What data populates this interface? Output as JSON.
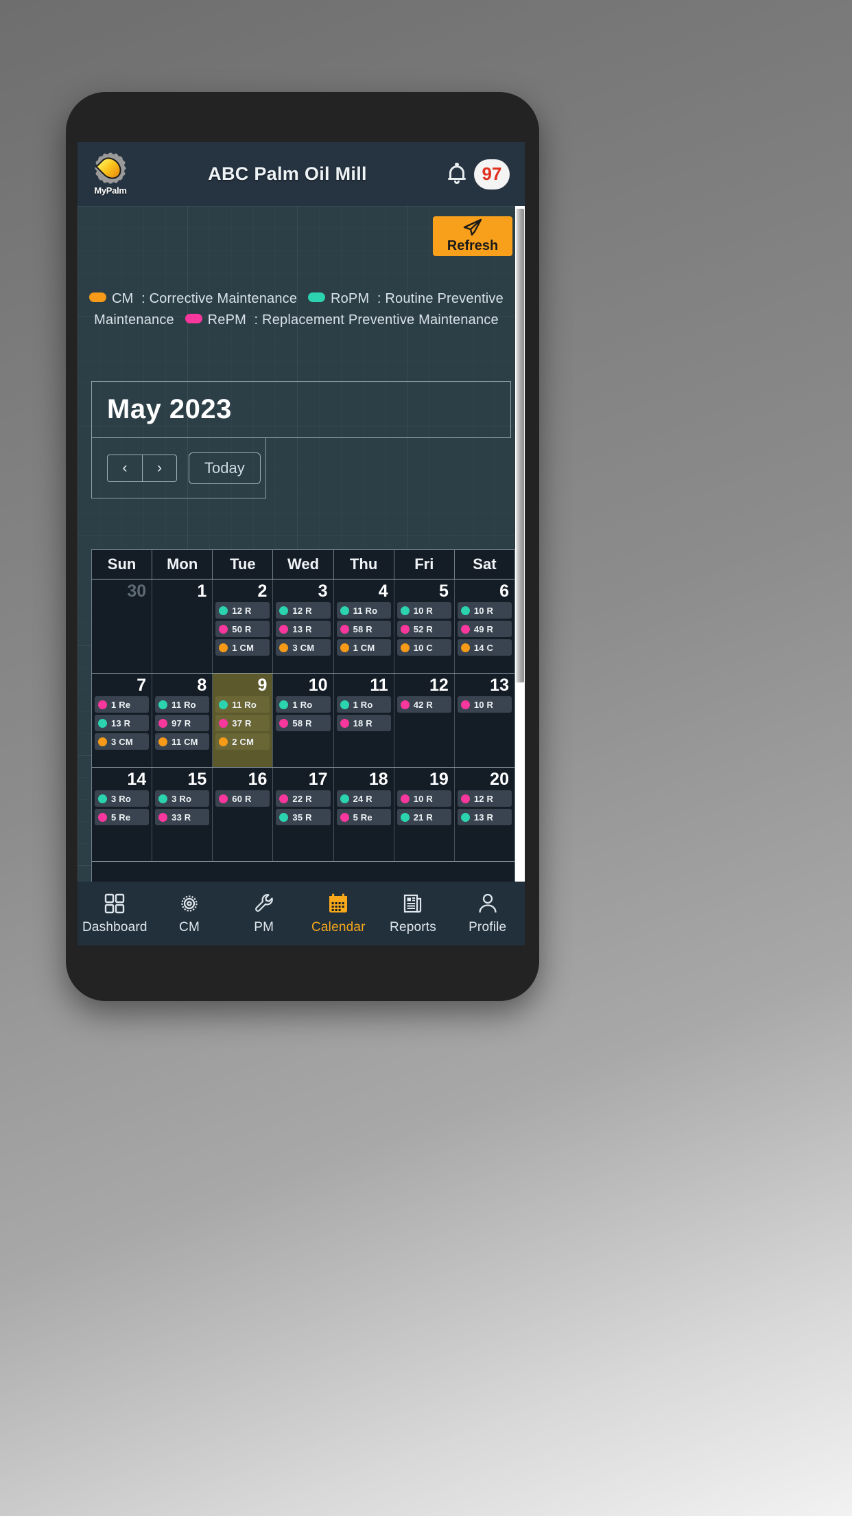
{
  "colors": {
    "cm": "#f79a18",
    "ropm": "#2bd4ae",
    "repm": "#f9379c",
    "accent": "#f8a01c",
    "appbar_bg": "#263340",
    "content_bg": "#2c3e46",
    "calendar_bg": "#141c26",
    "today_bg": "#5c5a2c",
    "badge_text": "#e03120"
  },
  "appbar": {
    "brand_label": "MyPalm",
    "title": "ABC Palm Oil Mill",
    "notification_count": "97"
  },
  "toolbar": {
    "refresh_label": "Refresh"
  },
  "legend": {
    "cm_code": "CM",
    "cm_text": ": Corrective Maintenance",
    "ropm_code": "RoPM",
    "ropm_text": ": Routine Preventive Maintenance",
    "repm_code": "RePM",
    "repm_text": ": Replacement Preventive Maintenance"
  },
  "calendar": {
    "month_label": "May 2023",
    "prev_label": "‹",
    "next_label": "›",
    "today_label": "Today",
    "dow": [
      "Sun",
      "Mon",
      "Tue",
      "Wed",
      "Thu",
      "Fri",
      "Sat"
    ],
    "weeks": [
      [
        {
          "num": "30",
          "muted": true,
          "chips": []
        },
        {
          "num": "1",
          "muted": false,
          "chips": []
        },
        {
          "num": "2",
          "muted": false,
          "chips": [
            {
              "type": "ropm",
              "text": "12 R"
            },
            {
              "type": "repm",
              "text": "50 R"
            },
            {
              "type": "cm",
              "text": "1 CM"
            }
          ]
        },
        {
          "num": "3",
          "muted": false,
          "chips": [
            {
              "type": "ropm",
              "text": "12 R"
            },
            {
              "type": "repm",
              "text": "13 R"
            },
            {
              "type": "cm",
              "text": "3 CM"
            }
          ]
        },
        {
          "num": "4",
          "muted": false,
          "chips": [
            {
              "type": "ropm",
              "text": "11 Ro"
            },
            {
              "type": "repm",
              "text": "58 R"
            },
            {
              "type": "cm",
              "text": "1 CM"
            }
          ]
        },
        {
          "num": "5",
          "muted": false,
          "chips": [
            {
              "type": "ropm",
              "text": "10 R"
            },
            {
              "type": "repm",
              "text": "52 R"
            },
            {
              "type": "cm",
              "text": "10 C"
            }
          ]
        },
        {
          "num": "6",
          "muted": false,
          "chips": [
            {
              "type": "ropm",
              "text": "10 R"
            },
            {
              "type": "repm",
              "text": "49 R"
            },
            {
              "type": "cm",
              "text": "14 C"
            }
          ]
        }
      ],
      [
        {
          "num": "7",
          "muted": false,
          "chips": [
            {
              "type": "repm",
              "text": "1 Re"
            },
            {
              "type": "ropm",
              "text": "13 R"
            },
            {
              "type": "cm",
              "text": "3 CM"
            }
          ]
        },
        {
          "num": "8",
          "muted": false,
          "chips": [
            {
              "type": "ropm",
              "text": "11 Ro"
            },
            {
              "type": "repm",
              "text": "97 R"
            },
            {
              "type": "cm",
              "text": "11 CM"
            }
          ]
        },
        {
          "num": "9",
          "muted": false,
          "today": true,
          "chips": [
            {
              "type": "ropm",
              "text": "11 Ro"
            },
            {
              "type": "repm",
              "text": "37 R"
            },
            {
              "type": "cm",
              "text": "2 CM"
            }
          ]
        },
        {
          "num": "10",
          "muted": false,
          "chips": [
            {
              "type": "ropm",
              "text": "1 Ro"
            },
            {
              "type": "repm",
              "text": "58 R"
            }
          ]
        },
        {
          "num": "11",
          "muted": false,
          "chips": [
            {
              "type": "ropm",
              "text": "1 Ro"
            },
            {
              "type": "repm",
              "text": "18 R"
            }
          ]
        },
        {
          "num": "12",
          "muted": false,
          "chips": [
            {
              "type": "repm",
              "text": "42 R"
            }
          ]
        },
        {
          "num": "13",
          "muted": false,
          "chips": [
            {
              "type": "repm",
              "text": "10 R"
            }
          ]
        }
      ],
      [
        {
          "num": "14",
          "muted": false,
          "chips": [
            {
              "type": "ropm",
              "text": "3 Ro"
            },
            {
              "type": "repm",
              "text": "5 Re"
            }
          ]
        },
        {
          "num": "15",
          "muted": false,
          "chips": [
            {
              "type": "ropm",
              "text": "3 Ro"
            },
            {
              "type": "repm",
              "text": "33 R"
            }
          ]
        },
        {
          "num": "16",
          "muted": false,
          "chips": [
            {
              "type": "repm",
              "text": "60 R"
            }
          ]
        },
        {
          "num": "17",
          "muted": false,
          "chips": [
            {
              "type": "repm",
              "text": "22 R"
            },
            {
              "type": "ropm",
              "text": "35 R"
            }
          ]
        },
        {
          "num": "18",
          "muted": false,
          "chips": [
            {
              "type": "ropm",
              "text": "24 R"
            },
            {
              "type": "repm",
              "text": "5 Re"
            }
          ]
        },
        {
          "num": "19",
          "muted": false,
          "chips": [
            {
              "type": "repm",
              "text": "10 R"
            },
            {
              "type": "ropm",
              "text": "21 R"
            }
          ]
        },
        {
          "num": "20",
          "muted": false,
          "chips": [
            {
              "type": "repm",
              "text": "12 R"
            },
            {
              "type": "ropm",
              "text": "13 R"
            }
          ]
        }
      ]
    ]
  },
  "bottomnav": {
    "items": [
      {
        "label": "Dashboard",
        "icon": "grid-icon",
        "active": false
      },
      {
        "label": "CM",
        "icon": "gear-icon",
        "active": false
      },
      {
        "label": "PM",
        "icon": "wrench-icon",
        "active": false
      },
      {
        "label": "Calendar",
        "icon": "calendar-icon",
        "active": true
      },
      {
        "label": "Reports",
        "icon": "newspaper-icon",
        "active": false
      },
      {
        "label": "Profile",
        "icon": "person-icon",
        "active": false
      }
    ]
  }
}
